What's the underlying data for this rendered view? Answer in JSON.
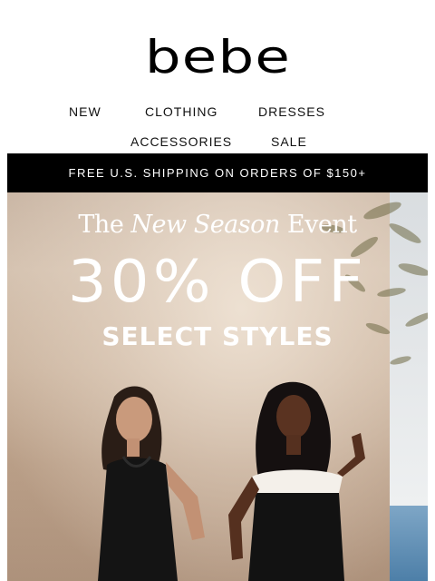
{
  "brand": {
    "logo_text": "bebe"
  },
  "nav": {
    "row1": [
      {
        "label": "NEW"
      },
      {
        "label": "CLOTHING"
      },
      {
        "label": "DRESSES"
      }
    ],
    "row2": [
      {
        "label": "ACCESSORIES"
      },
      {
        "label": "SALE"
      }
    ]
  },
  "promo_bar": {
    "text": "FREE U.S. SHIPPING ON ORDERS OF $150+"
  },
  "hero": {
    "event_title_pre": "The",
    "event_title_italic": "New Season",
    "event_title_post": "Event",
    "headline": "30% OFF",
    "subheadline": "SELECT STYLES"
  },
  "colors": {
    "promo_bg": "#000000",
    "text_light": "#ffffff",
    "accent": "#000000"
  }
}
